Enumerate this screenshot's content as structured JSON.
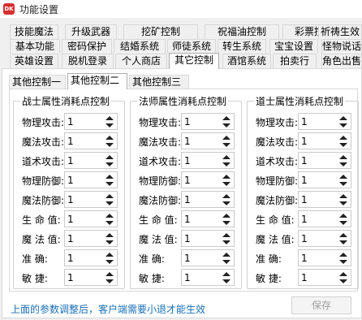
{
  "window": {
    "icon_text": "DK",
    "title": "功能设置"
  },
  "tabs": {
    "row1": [
      "技能魔法",
      "升级武器",
      "挖矿控制",
      "祝福油控制",
      "彩票控制",
      "祈祷生效"
    ],
    "row2": [
      "基本功能",
      "密码保护",
      "结婚系统",
      "师徒系统",
      "转生系统",
      "宝宝设置",
      "怪物说话"
    ],
    "row3": [
      "英雄设置",
      "脱机登录",
      "个人商店",
      "其它控制",
      "酒馆系统",
      "拍卖行",
      "角色出售"
    ]
  },
  "subtabs": [
    "其他控制一",
    "其他控制二",
    "其他控制三"
  ],
  "groups": [
    {
      "title": "战士属性消耗点控制",
      "rows": [
        {
          "label": "物理攻击:",
          "value": "1"
        },
        {
          "label": "魔法攻击:",
          "value": "1"
        },
        {
          "label": "道术攻击:",
          "value": "1"
        },
        {
          "label": "物理防御:",
          "value": "1"
        },
        {
          "label": "魔法防御:",
          "value": "1"
        },
        {
          "label": "生 命 值:",
          "value": "1"
        },
        {
          "label": "魔 法 值:",
          "value": "1"
        },
        {
          "label": "准    确:",
          "value": "1"
        },
        {
          "label": "敏    捷:",
          "value": "1"
        }
      ]
    },
    {
      "title": "法师属性消耗点控制",
      "rows": [
        {
          "label": "物理攻击:",
          "value": "1"
        },
        {
          "label": "魔法攻击:",
          "value": "1"
        },
        {
          "label": "道术攻击:",
          "value": "1"
        },
        {
          "label": "物理防御:",
          "value": "1"
        },
        {
          "label": "魔法防御:",
          "value": "1"
        },
        {
          "label": "生 命 值:",
          "value": "1"
        },
        {
          "label": "魔 法 值:",
          "value": "1"
        },
        {
          "label": "准    确:",
          "value": "1"
        },
        {
          "label": "敏    捷:",
          "value": "1"
        }
      ]
    },
    {
      "title": "道士属性消耗点控制",
      "rows": [
        {
          "label": "物理攻击:",
          "value": "1"
        },
        {
          "label": "魔法攻击:",
          "value": "1"
        },
        {
          "label": "道术攻击:",
          "value": "1"
        },
        {
          "label": "物理防御:",
          "value": "1"
        },
        {
          "label": "魔法防御:",
          "value": "1"
        },
        {
          "label": "生 命 值:",
          "value": "1"
        },
        {
          "label": "魔 法 值:",
          "value": "1"
        },
        {
          "label": "准    确:",
          "value": "1"
        },
        {
          "label": "敏    捷:",
          "value": "1"
        }
      ]
    }
  ],
  "footer": {
    "note": "上面的参数调整后，客户端需要小退才能生效",
    "save_label": "保存"
  },
  "colors": {
    "note_text": "#1a6fb5",
    "app_icon": "#d62e2e",
    "disabled_text": "#a0a0a0"
  }
}
